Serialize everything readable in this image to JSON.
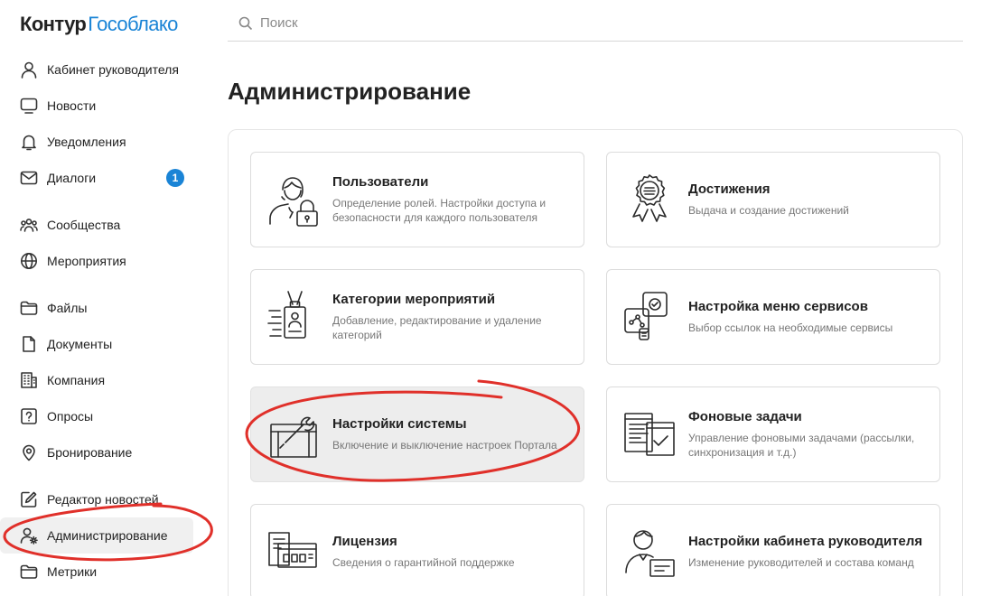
{
  "logo": {
    "part1": "Контур",
    "part2": "Гособлако"
  },
  "search": {
    "placeholder": "Поиск"
  },
  "page_title": "Администрирование",
  "sidebar": {
    "items": [
      {
        "label": "Кабинет руководителя",
        "icon": "user-icon"
      },
      {
        "label": "Новости",
        "icon": "monitor-icon"
      },
      {
        "label": "Уведомления",
        "icon": "bell-icon"
      },
      {
        "label": "Диалоги",
        "icon": "mail-icon",
        "badge": "1"
      },
      {
        "label": "Сообщества",
        "icon": "group-icon"
      },
      {
        "label": "Мероприятия",
        "icon": "globe-icon"
      },
      {
        "label": "Файлы",
        "icon": "folder-icon"
      },
      {
        "label": "Документы",
        "icon": "document-icon"
      },
      {
        "label": "Компания",
        "icon": "building-icon"
      },
      {
        "label": "Опросы",
        "icon": "question-icon"
      },
      {
        "label": "Бронирование",
        "icon": "location-pin-icon"
      },
      {
        "label": "Редактор новостей",
        "icon": "pencil-icon"
      },
      {
        "label": "Администрирование",
        "icon": "user-gear-icon"
      },
      {
        "label": "Метрики",
        "icon": "folder-chart-icon"
      }
    ]
  },
  "cards": [
    {
      "title": "Пользователи",
      "desc": "Определение ролей. Настройки доступа и безопасности для каждого пользователя",
      "icon": "user-lock-icon"
    },
    {
      "title": "Достижения",
      "desc": "Выдача и создание достижений",
      "icon": "award-badge-icon"
    },
    {
      "title": "Категории мероприятий",
      "desc": "Добавление, редактирование и удаление категорий",
      "icon": "badge-lanyard-icon"
    },
    {
      "title": "Настройка меню сервисов",
      "desc": "Выбор ссылок на необходимые сервисы",
      "icon": "services-menu-icon"
    },
    {
      "title": "Настройки системы",
      "desc": "Включение и выключение настроек Портала",
      "icon": "toolbox-wrench-icon"
    },
    {
      "title": "Фоновые задачи",
      "desc": "Управление фоновыми задачами (рассылки, синхронизация и т.д.)",
      "icon": "background-tasks-icon"
    },
    {
      "title": "Лицензия",
      "desc": "Сведения о гарантийной поддержке",
      "icon": "license-docs-icon"
    },
    {
      "title": "Настройки кабинета руководителя",
      "desc": "Изменение руководителей и состава команд",
      "icon": "manager-card-icon"
    }
  ],
  "colors": {
    "accent": "#1a84d6",
    "annotation": "#e0302a",
    "selected_bg": "#ededed"
  }
}
